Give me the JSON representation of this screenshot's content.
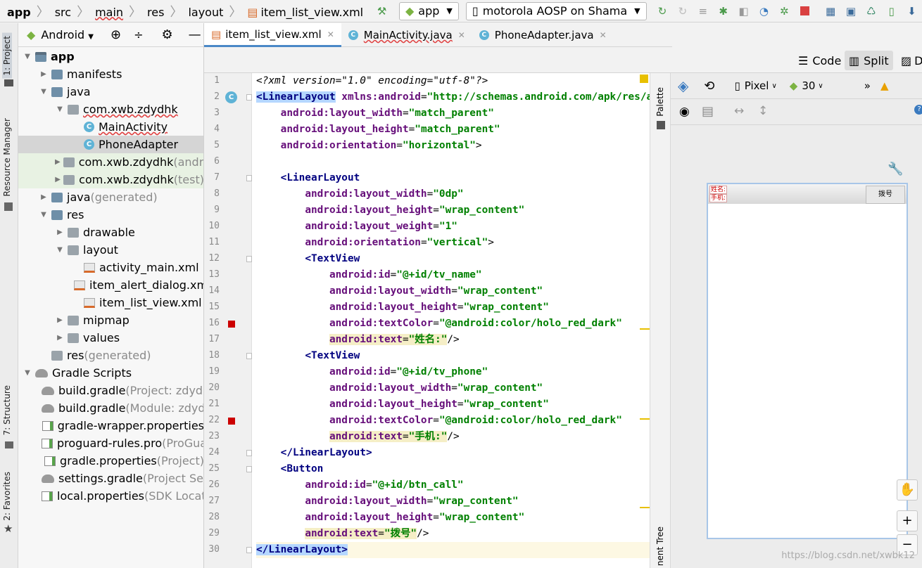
{
  "breadcrumb": [
    "app",
    "src",
    "main",
    "res",
    "layout",
    "item_list_view.xml"
  ],
  "run_config": "app",
  "device": "motorola AOSP on Shama",
  "side_tabs": {
    "project": "1: Project",
    "resource": "Resource Manager",
    "structure": "7: Structure",
    "favorites": "2: Favorites"
  },
  "project_view": "Android",
  "tree": [
    {
      "label": "app",
      "indent": 0,
      "arrow": "▼",
      "icon": "folder mod",
      "bold": true
    },
    {
      "label": "manifests",
      "indent": 1,
      "arrow": "▶",
      "icon": "folder"
    },
    {
      "label": "java",
      "indent": 1,
      "arrow": "▼",
      "icon": "folder"
    },
    {
      "label": "com.xwb.zdydhk",
      "indent": 2,
      "arrow": "▼",
      "icon": "folder grey",
      "wavy": true
    },
    {
      "label": "MainActivity",
      "indent": 3,
      "arrow": "",
      "icon": "cls",
      "wavy": true
    },
    {
      "label": "PhoneAdapter",
      "indent": 3,
      "arrow": "",
      "icon": "cls",
      "sel": true
    },
    {
      "label": "com.xwb.zdydhk",
      "hint": " (andro",
      "indent": 2,
      "arrow": "▶",
      "icon": "folder grey",
      "green": true
    },
    {
      "label": "com.xwb.zdydhk",
      "hint": " (test)",
      "indent": 2,
      "arrow": "▶",
      "icon": "folder grey",
      "green": true
    },
    {
      "label": "java",
      "hint": " (generated)",
      "indent": 1,
      "arrow": "▶",
      "icon": "folder"
    },
    {
      "label": "res",
      "indent": 1,
      "arrow": "▼",
      "icon": "folder"
    },
    {
      "label": "drawable",
      "indent": 2,
      "arrow": "▶",
      "icon": "folder grey"
    },
    {
      "label": "layout",
      "indent": 2,
      "arrow": "▼",
      "icon": "folder grey"
    },
    {
      "label": "activity_main.xml",
      "indent": 3,
      "arrow": "",
      "icon": "xmlf"
    },
    {
      "label": "item_alert_dialog.xml",
      "indent": 3,
      "arrow": "",
      "icon": "xmlf"
    },
    {
      "label": "item_list_view.xml",
      "indent": 3,
      "arrow": "",
      "icon": "xmlf"
    },
    {
      "label": "mipmap",
      "indent": 2,
      "arrow": "▶",
      "icon": "folder grey"
    },
    {
      "label": "values",
      "indent": 2,
      "arrow": "▶",
      "icon": "folder grey"
    },
    {
      "label": "res",
      "hint": " (generated)",
      "indent": 1,
      "arrow": "",
      "icon": "folder grey"
    },
    {
      "label": "Gradle Scripts",
      "indent": 0,
      "arrow": "▼",
      "icon": "grad"
    },
    {
      "label": "build.gradle",
      "hint": " (Project: zdydhk)",
      "indent": 1,
      "arrow": "",
      "icon": "grad"
    },
    {
      "label": "build.gradle",
      "hint": " (Module: zdydhk)",
      "indent": 1,
      "arrow": "",
      "icon": "grad"
    },
    {
      "label": "gradle-wrapper.properties",
      "indent": 1,
      "arrow": "",
      "icon": "propf"
    },
    {
      "label": "proguard-rules.pro",
      "hint": " (ProGuard)",
      "indent": 1,
      "arrow": "",
      "icon": "propf"
    },
    {
      "label": "gradle.properties",
      "hint": " (Project)",
      "indent": 1,
      "arrow": "",
      "icon": "propf"
    },
    {
      "label": "settings.gradle",
      "hint": " (Project Settings)",
      "indent": 1,
      "arrow": "",
      "icon": "grad"
    },
    {
      "label": "local.properties",
      "hint": " (SDK Location)",
      "indent": 1,
      "arrow": "",
      "icon": "propf"
    }
  ],
  "tabs": [
    {
      "label": "item_list_view.xml",
      "active": true
    },
    {
      "label": "MainActivity.java",
      "active": false,
      "wavy": true
    },
    {
      "label": "PhoneAdapter.java",
      "active": false
    }
  ],
  "view_modes": {
    "code": "Code",
    "split": "Split",
    "design": "De"
  },
  "design_bar": {
    "device": "Pixel",
    "api": "30"
  },
  "palette_label": "Palette",
  "component_tree_label": "nent Tree",
  "preview": {
    "name_label": "姓名:",
    "phone_label": "手机:",
    "button": "拨号"
  },
  "watermark": "https://blog.csdn.net/xwbk12",
  "code": [
    [
      [
        "pi",
        "<?xml version=\"1.0\" encoding=\"utf-8\"?>"
      ]
    ],
    [
      [
        "tg mh",
        "<LinearLayout"
      ],
      [
        "at",
        " xmlns:android"
      ],
      [
        "",
        "="
      ],
      [
        "av",
        "\"http://schemas.android.com/apk/res/android\""
      ]
    ],
    [
      [
        "",
        "    "
      ],
      [
        "at",
        "android:layout_width"
      ],
      [
        "",
        "="
      ],
      [
        "av",
        "\"match_parent\""
      ]
    ],
    [
      [
        "",
        "    "
      ],
      [
        "at",
        "android:layout_height"
      ],
      [
        "",
        "="
      ],
      [
        "av",
        "\"match_parent\""
      ]
    ],
    [
      [
        "",
        "    "
      ],
      [
        "at",
        "android:orientation"
      ],
      [
        "",
        "="
      ],
      [
        "av",
        "\"horizontal\""
      ],
      [
        "",
        ">"
      ]
    ],
    [
      [
        "",
        ""
      ]
    ],
    [
      [
        "",
        "    "
      ],
      [
        "tg",
        "<LinearLayout"
      ]
    ],
    [
      [
        "",
        "        "
      ],
      [
        "at",
        "android:layout_width"
      ],
      [
        "",
        "="
      ],
      [
        "av",
        "\"0dp\""
      ]
    ],
    [
      [
        "",
        "        "
      ],
      [
        "at",
        "android:layout_height"
      ],
      [
        "",
        "="
      ],
      [
        "av",
        "\"wrap_content\""
      ]
    ],
    [
      [
        "",
        "        "
      ],
      [
        "at",
        "android:layout_weight"
      ],
      [
        "",
        "="
      ],
      [
        "av",
        "\"1\""
      ]
    ],
    [
      [
        "",
        "        "
      ],
      [
        "at",
        "android:orientation"
      ],
      [
        "",
        "="
      ],
      [
        "av",
        "\"vertical\""
      ],
      [
        "",
        ">"
      ]
    ],
    [
      [
        "",
        "        "
      ],
      [
        "tg",
        "<TextView"
      ]
    ],
    [
      [
        "",
        "            "
      ],
      [
        "at",
        "android:id"
      ],
      [
        "",
        "="
      ],
      [
        "av",
        "\"@+id/tv_name\""
      ]
    ],
    [
      [
        "",
        "            "
      ],
      [
        "at",
        "android:layout_width"
      ],
      [
        "",
        "="
      ],
      [
        "av",
        "\"wrap_content\""
      ]
    ],
    [
      [
        "",
        "            "
      ],
      [
        "at",
        "android:layout_height"
      ],
      [
        "",
        "="
      ],
      [
        "av",
        "\"wrap_content\""
      ]
    ],
    [
      [
        "",
        "            "
      ],
      [
        "at",
        "android:textColor"
      ],
      [
        "",
        "="
      ],
      [
        "av",
        "\"@android:color/holo_red_dark\""
      ]
    ],
    [
      [
        "",
        "            "
      ],
      [
        "at ww",
        "android:text"
      ],
      [
        "ww",
        "="
      ],
      [
        "av ww",
        "\"姓名:\""
      ],
      [
        "",
        "/>"
      ]
    ],
    [
      [
        "",
        "        "
      ],
      [
        "tg",
        "<TextView"
      ]
    ],
    [
      [
        "",
        "            "
      ],
      [
        "at",
        "android:id"
      ],
      [
        "",
        "="
      ],
      [
        "av",
        "\"@+id/tv_phone\""
      ]
    ],
    [
      [
        "",
        "            "
      ],
      [
        "at",
        "android:layout_width"
      ],
      [
        "",
        "="
      ],
      [
        "av",
        "\"wrap_content\""
      ]
    ],
    [
      [
        "",
        "            "
      ],
      [
        "at",
        "android:layout_height"
      ],
      [
        "",
        "="
      ],
      [
        "av",
        "\"wrap_content\""
      ]
    ],
    [
      [
        "",
        "            "
      ],
      [
        "at",
        "android:textColor"
      ],
      [
        "",
        "="
      ],
      [
        "av",
        "\"@android:color/holo_red_dark\""
      ]
    ],
    [
      [
        "",
        "            "
      ],
      [
        "at ww",
        "android:text"
      ],
      [
        "ww",
        "="
      ],
      [
        "av ww",
        "\"手机:\""
      ],
      [
        "",
        "/>"
      ]
    ],
    [
      [
        "",
        "    "
      ],
      [
        "tg",
        "</LinearLayout>"
      ]
    ],
    [
      [
        "",
        "    "
      ],
      [
        "tg",
        "<Button"
      ]
    ],
    [
      [
        "",
        "        "
      ],
      [
        "at",
        "android:id"
      ],
      [
        "",
        "="
      ],
      [
        "av",
        "\"@+id/btn_call\""
      ]
    ],
    [
      [
        "",
        "        "
      ],
      [
        "at",
        "android:layout_width"
      ],
      [
        "",
        "="
      ],
      [
        "av",
        "\"wrap_content\""
      ]
    ],
    [
      [
        "",
        "        "
      ],
      [
        "at",
        "android:layout_height"
      ],
      [
        "",
        "="
      ],
      [
        "av",
        "\"wrap_content\""
      ]
    ],
    [
      [
        "",
        "        "
      ],
      [
        "at ww",
        "android:text"
      ],
      [
        "ww",
        "="
      ],
      [
        "av ww",
        "\"拨号\""
      ],
      [
        "",
        "/>"
      ]
    ],
    [
      [
        "tg mh",
        "</LinearLayout>"
      ]
    ]
  ]
}
